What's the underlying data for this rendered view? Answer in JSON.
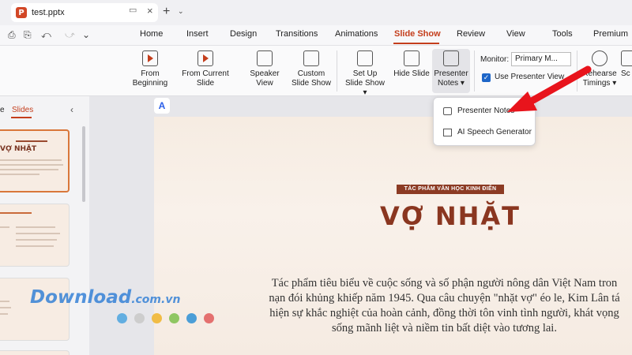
{
  "titlebar": {
    "file_name": "test.pptx",
    "app_icon_letter": "P",
    "close_glyph": "×",
    "new_tab_glyph": "+",
    "menu_glyph": "⌄"
  },
  "menu": {
    "items": [
      "Home",
      "Insert",
      "Design",
      "Transitions",
      "Animations",
      "Slide Show",
      "Review",
      "View",
      "Tools",
      "Premium"
    ],
    "active": "Slide Show",
    "quick_access": [
      "⎙",
      "⎘",
      "⤺",
      "⤻",
      "⌄"
    ]
  },
  "ribbon": {
    "from_beginning": [
      "From",
      "Beginning"
    ],
    "from_current": "From Current Slide",
    "speaker_view": "Speaker View",
    "custom_show": [
      "Custom",
      "Slide Show"
    ],
    "set_up": [
      "Set Up",
      "Slide Show ▾"
    ],
    "hide_slide": "Hide Slide",
    "presenter_notes": [
      "Presenter",
      "Notes ▾"
    ],
    "monitor_label": "Monitor:",
    "monitor_value": "Primary M...",
    "use_presenter_label": "Use Presenter View",
    "rehearse": [
      "Rehearse",
      "Timings ▾"
    ],
    "screen_partial": "Sc"
  },
  "panel": {
    "tab_outline_partial": "e",
    "tab_slides": "Slides",
    "collapse_glyph": "‹",
    "thumb1_title": "VỢ NHẶT"
  },
  "dropdown": {
    "items": [
      "Presenter Notes",
      "AI Speech Generator"
    ]
  },
  "slide": {
    "badge": "TÁC PHẨM VĂN HỌC KINH ĐIỂN",
    "title": "VỢ NHẶT",
    "body_lines": [
      "Tác phẩm tiêu biểu về cuộc sống và số phận người nông dân Việt Nam tron",
      "nạn đói khủng khiếp năm 1945. Qua câu chuyện \"nhặt vợ\" éo le, Kim Lân tá",
      "hiện sự khắc nghiệt của hoàn cảnh, đồng thời tôn vinh tình người, khát vọng",
      "sống mãnh liệt và niềm tin bất diệt vào tương lai."
    ]
  },
  "watermark": {
    "text": "Download",
    "suffix": ".com.vn",
    "dot_colors": [
      "#4aa3df",
      "#c8c8c8",
      "#f0b429",
      "#7cc04b",
      "#2d8fd5",
      "#e05a5a"
    ]
  },
  "colors": {
    "accent": "#c43e1c",
    "slide_title": "#8a3620",
    "arrow": "#e8141c"
  }
}
